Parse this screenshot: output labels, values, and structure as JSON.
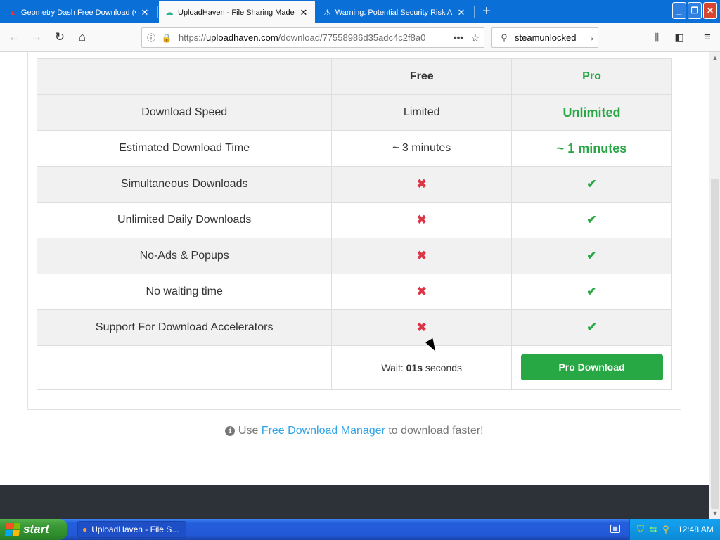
{
  "browser": {
    "tabs": [
      {
        "title": "Geometry Dash Free Download (v",
        "icon": "red-document-icon",
        "active": false
      },
      {
        "title": "UploadHaven - File Sharing Made E",
        "icon": "uploadhaven-cloud-icon",
        "active": true
      },
      {
        "title": "Warning: Potential Security Risk A",
        "icon": "warning-icon",
        "active": false
      }
    ],
    "new_tab_label": "+",
    "window_buttons": {
      "minimize": "_",
      "restore": "❐",
      "close": "✕"
    },
    "url_prefix": "https://",
    "url_domain": "uploadhaven.com",
    "url_path": "/download/77558986d35adc4c2f8a0",
    "search_text": "steamunlocked"
  },
  "table": {
    "headers": [
      "",
      "Free",
      "Pro"
    ],
    "rows": [
      {
        "feature": "Download Speed",
        "free": "Limited",
        "pro": "Unlimited",
        "pro_style": "text"
      },
      {
        "feature": "Estimated Download Time",
        "free": "~ 3 minutes",
        "pro": "~ 1 minutes",
        "pro_style": "text"
      },
      {
        "feature": "Simultaneous Downloads",
        "free": "✖",
        "pro": "✔",
        "pro_style": "icon"
      },
      {
        "feature": "Unlimited Daily Downloads",
        "free": "✖",
        "pro": "✔",
        "pro_style": "icon"
      },
      {
        "feature": "No-Ads & Popups",
        "free": "✖",
        "pro": "✔",
        "pro_style": "icon"
      },
      {
        "feature": "No waiting time",
        "free": "✖",
        "pro": "✔",
        "pro_style": "icon"
      },
      {
        "feature": "Support For Download Accelerators",
        "free": "✖",
        "pro": "✔",
        "pro_style": "icon"
      }
    ],
    "wait_prefix": "Wait: ",
    "wait_value": "01s",
    "wait_suffix": " seconds",
    "pro_download_label": "Pro Download"
  },
  "info": {
    "prefix": " Use ",
    "link": "Free Download Manager",
    "suffix": " to download faster!"
  },
  "taskbar": {
    "start_label": "start",
    "task_label": "UploadHaven - File S...",
    "clock": "12:48 AM"
  },
  "colors": {
    "accent_green": "#28a745",
    "cross_red": "#dc3545",
    "link_blue": "#2fa4e7",
    "tab_bar_blue": "#0b6fd8"
  }
}
